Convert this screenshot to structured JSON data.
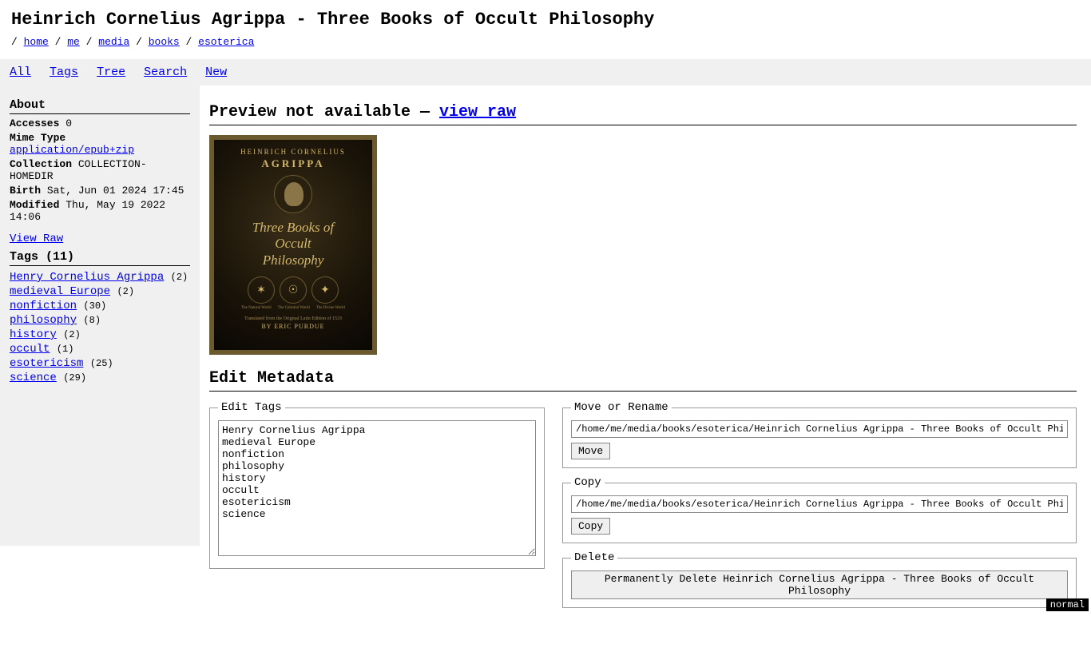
{
  "page_title": "Heinrich Cornelius Agrippa - Three Books of Occult Philosophy",
  "breadcrumb": [
    "home",
    "me",
    "media",
    "books",
    "esoterica"
  ],
  "topnav": {
    "all": "All",
    "tags": "Tags",
    "tree": "Tree",
    "search": "Search",
    "new": "New"
  },
  "sidebar": {
    "about_heading": "About",
    "meta": {
      "accesses_label": "Accesses",
      "accesses_value": "0",
      "mime_label": "Mime Type",
      "mime_value": "application/epub+zip",
      "collection_label": "Collection",
      "collection_value": "COLLECTION-HOMEDIR",
      "birth_label": "Birth",
      "birth_value": "Sat, Jun 01 2024 17:45",
      "modified_label": "Modified",
      "modified_value": "Thu, May 19 2022 14:06"
    },
    "view_raw": "View Raw",
    "tags_heading": "Tags (11)",
    "tags": [
      {
        "name": "Henry Cornelius Agrippa",
        "count": "(2)"
      },
      {
        "name": "medieval Europe",
        "count": "(2)"
      },
      {
        "name": "nonfiction",
        "count": "(30)"
      },
      {
        "name": "philosophy",
        "count": "(8)"
      },
      {
        "name": "history",
        "count": "(2)"
      },
      {
        "name": "occult",
        "count": "(1)"
      },
      {
        "name": "esotericism",
        "count": "(25)"
      },
      {
        "name": "science",
        "count": "(29)"
      }
    ]
  },
  "main": {
    "preview_prefix": "Preview not available — ",
    "view_raw_link": "view raw",
    "cover": {
      "author_top": "HEINRICH CORNELIUS",
      "author_name": "AGRIPPA",
      "title_line1": "Three Books of",
      "title_line2": "Occult",
      "title_line3": "Philosophy",
      "sub1": "The Natural World",
      "sub2": "The Celestial World",
      "sub3": "The Divine World",
      "translated": "Translated from the Original Latin Edition of 1533",
      "editor": "BY ERIC PURDUE"
    },
    "edit_metadata_heading": "Edit Metadata",
    "edit_tags": {
      "legend": "Edit Tags",
      "value": "Henry Cornelius Agrippa\nmedieval Europe\nnonfiction\nphilosophy\nhistory\noccult\nesotericism\nscience"
    },
    "move": {
      "legend": "Move or Rename",
      "value": "/home/me/media/books/esoterica/Heinrich Cornelius Agrippa - Three Books of Occult Philosophy.epub",
      "button": "Move"
    },
    "copy": {
      "legend": "Copy",
      "value": "/home/me/media/books/esoterica/Heinrich Cornelius Agrippa - Three Books of Occult Philosophy.epub",
      "button": "Copy"
    },
    "delete": {
      "legend": "Delete",
      "button": "Permanently Delete Heinrich Cornelius Agrippa - Three Books of Occult Philosophy"
    }
  },
  "status": "normal"
}
